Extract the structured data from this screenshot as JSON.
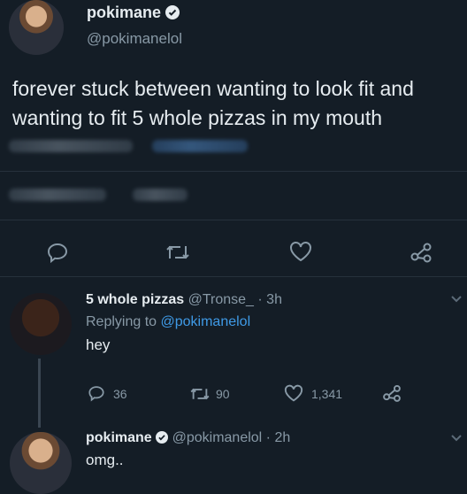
{
  "main_tweet": {
    "display_name": "pokimane",
    "handle": "@pokimanelol",
    "text_line1": "forever stuck between wanting to look fit and",
    "text_line2": "wanting to fit 5 whole pizzas in my mouth"
  },
  "reply": {
    "display_name": "5 whole pizzas",
    "handle": "@Tronse_",
    "time": "· 3h",
    "replying_prefix": "Replying to",
    "replying_to": "@pokimanelol",
    "text": "hey",
    "reply_count": "36",
    "retweet_count": "90",
    "like_count": "1,341"
  },
  "reply2": {
    "display_name": "pokimane",
    "handle": "@pokimanelol",
    "time": "· 2h",
    "text": "omg.."
  },
  "colors": {
    "background": "#141d26",
    "text": "#e6ecf0",
    "muted": "#8899a6",
    "link": "#3f9ae6"
  },
  "icons": [
    "verified-badge-icon",
    "reply-icon",
    "retweet-icon",
    "like-icon",
    "share-icon",
    "chevron-down-icon"
  ]
}
